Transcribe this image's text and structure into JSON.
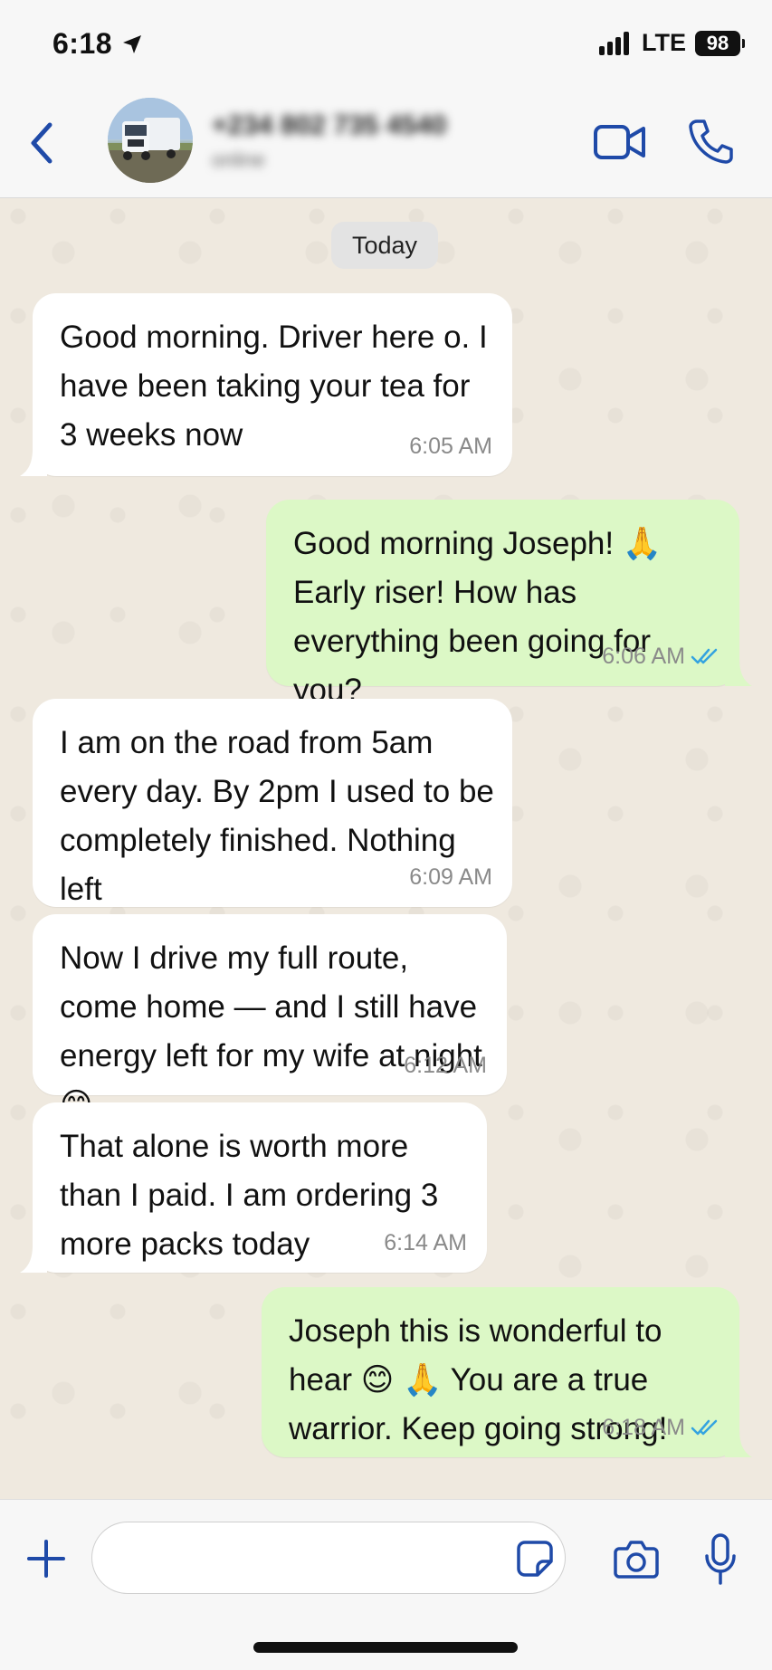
{
  "status_bar": {
    "time": "6:18",
    "network": "LTE",
    "battery": "98"
  },
  "header": {
    "contact_name": "+234 802 735 4540",
    "contact_status": "online",
    "avatar": "truck-photo",
    "icons": {
      "back": "chevron-left-icon",
      "video": "video-camera-icon",
      "call": "phone-icon"
    }
  },
  "chat": {
    "date_label": "Today",
    "messages": [
      {
        "direction": "in",
        "text": "Good morning. Driver here o. I have been taking your tea for 3 weeks now",
        "time": "6:05 AM"
      },
      {
        "direction": "out",
        "text": "Good morning Joseph! 🙏 Early riser! How has everything been going for you?",
        "time": "6:06 AM",
        "status": "read"
      },
      {
        "direction": "in",
        "text": "I am on the road from 5am every day. By 2pm I used to be completely finished. Nothing left",
        "time": "6:09 AM"
      },
      {
        "direction": "in",
        "text": "Now I drive my full route, come home — and I still have energy left for my wife at night 😊",
        "time": "6:12 AM"
      },
      {
        "direction": "in",
        "text": "That alone is worth more than I paid. I am ordering 3 more packs today",
        "time": "6:14 AM"
      },
      {
        "direction": "out",
        "text": "Joseph this is wonderful to hear 😊 🙏 You are a true warrior. Keep going strong!",
        "time": "6:18 AM",
        "status": "read"
      }
    ]
  },
  "input_bar": {
    "placeholder": "",
    "value": "",
    "icons": {
      "attach": "plus-icon",
      "sticker": "sticker-icon",
      "camera": "camera-icon",
      "mic": "microphone-icon"
    }
  },
  "colors": {
    "accent": "#1f4aa8",
    "incoming_bubble": "#ffffff",
    "outgoing_bubble": "#dcf8c6",
    "chat_background": "#efe9df",
    "read_ticks": "#34a3e0"
  }
}
